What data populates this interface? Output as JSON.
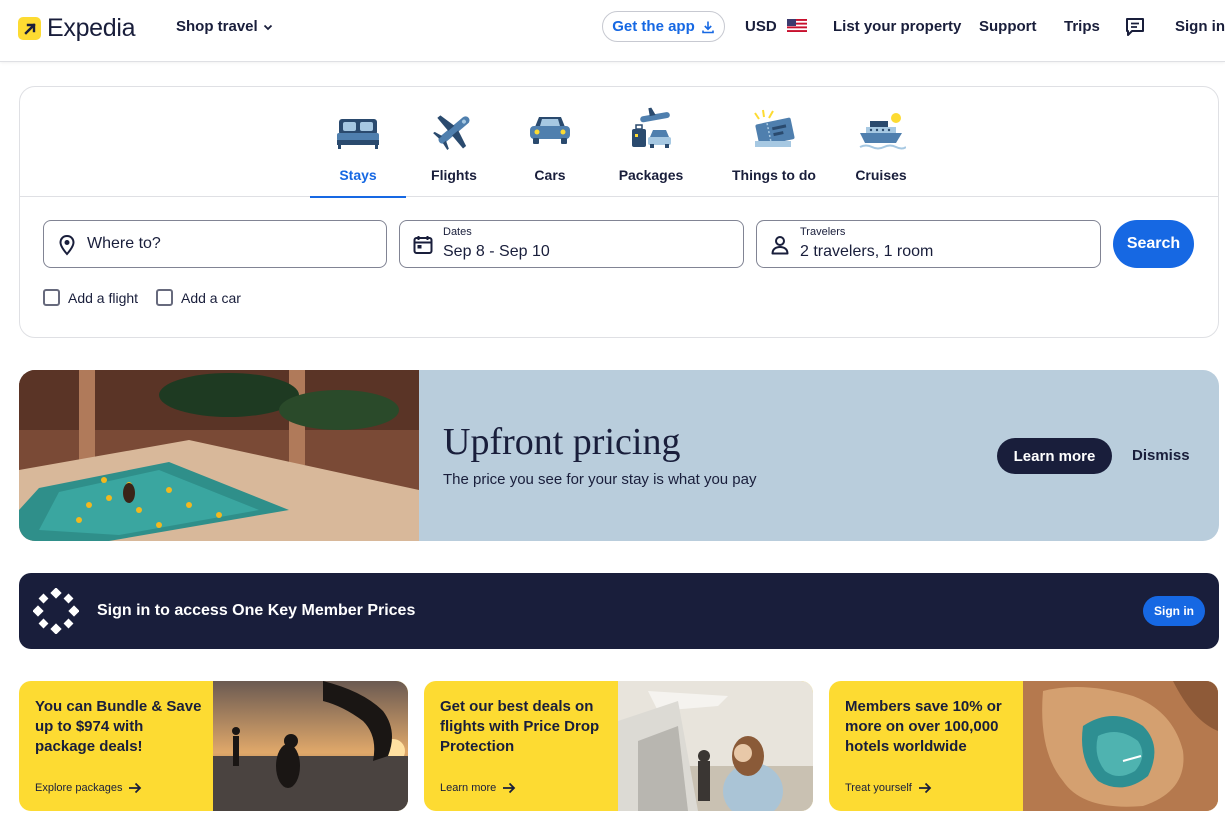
{
  "header": {
    "brand": "Expedia",
    "shop_travel": "Shop travel",
    "get_app": "Get the app",
    "currency": "USD",
    "list_property": "List your property",
    "support": "Support",
    "trips": "Trips",
    "sign_in": "Sign in"
  },
  "tabs": [
    {
      "label": "Stays",
      "icon": "bed-icon",
      "active": true
    },
    {
      "label": "Flights",
      "icon": "plane-icon"
    },
    {
      "label": "Cars",
      "icon": "car-icon"
    },
    {
      "label": "Packages",
      "icon": "packages-icon"
    },
    {
      "label": "Things to do",
      "icon": "ticket-icon"
    },
    {
      "label": "Cruises",
      "icon": "cruise-ship-icon"
    }
  ],
  "search": {
    "destination_placeholder": "Where to?",
    "dates_label": "Dates",
    "dates_value": "Sep 8 - Sep 10",
    "travelers_label": "Travelers",
    "travelers_value": "2 travelers, 1 room",
    "search_button": "Search",
    "add_flight": "Add a flight",
    "add_car": "Add a car"
  },
  "promo": {
    "title": "Upfront pricing",
    "subtitle": "The price you see for your stay is what you pay",
    "learn_more": "Learn more",
    "dismiss": "Dismiss"
  },
  "onekey": {
    "text": "Sign in to access One Key Member Prices",
    "button": "Sign in"
  },
  "deals": [
    {
      "text": "You can Bundle & Save up to $974 with package deals!",
      "link": "Explore packages"
    },
    {
      "text": "Get our best deals on flights with Price Drop Protection",
      "link": "Learn more"
    },
    {
      "text": "Members save 10% or more on over 100,000 hotels worldwide",
      "link": "Treat yourself"
    }
  ],
  "colors": {
    "brand_blue": "#1668e3",
    "navy": "#191e3b",
    "yellow": "#fddb32",
    "promo_bg": "#b9cddc"
  }
}
